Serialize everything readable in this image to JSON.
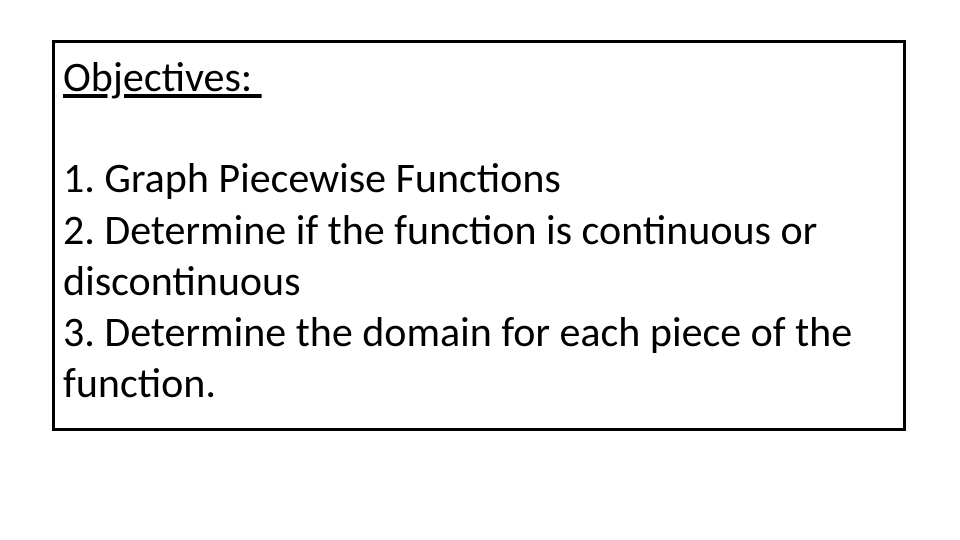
{
  "heading": "Objectives: ",
  "items": [
    "1. Graph Piecewise Functions",
    "2. Determine if the function is continuous or discontinuous",
    "3. Determine the domain for each piece of the function."
  ]
}
